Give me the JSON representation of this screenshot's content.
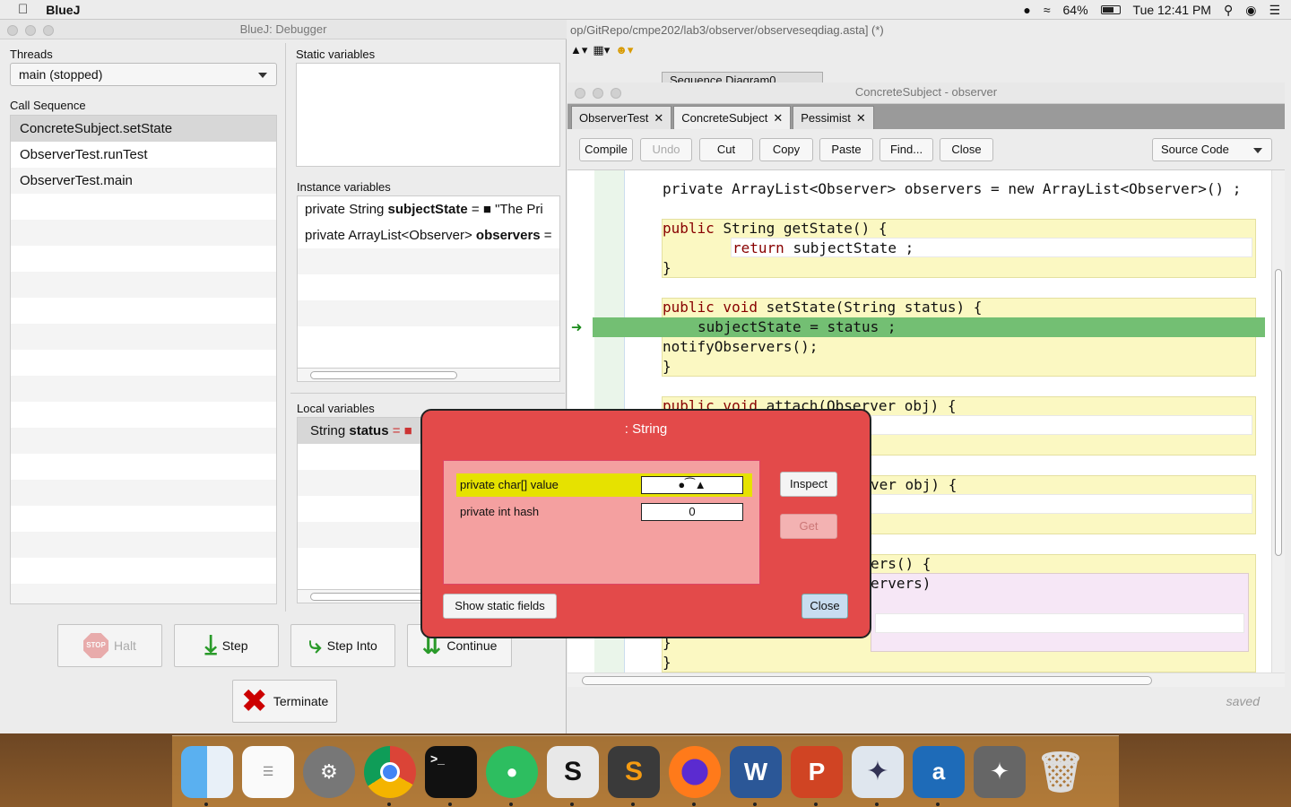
{
  "menubar": {
    "app_name": "BlueJ",
    "battery": "64%",
    "clock": "Tue 12:41 PM"
  },
  "editor_window": {
    "path_title": "op/GitRepo/cmpe202/lab3/observer/observeseqdiag.asta] (*)",
    "diagram_tab": "Sequence Diagram0",
    "class_window_title": "ConcreteSubject - observer",
    "tabs": [
      {
        "label": "ObserverTest"
      },
      {
        "label": "ConcreteSubject"
      },
      {
        "label": "Pessimist"
      }
    ],
    "toolbar": {
      "compile": "Compile",
      "undo": "Undo",
      "cut": "Cut",
      "copy": "Copy",
      "paste": "Paste",
      "find": "Find...",
      "close": "Close",
      "view_mode": "Source Code"
    },
    "code": {
      "l1": "private ArrayList<Observer> observers = new ArrayList<Observer>() ;",
      "l2a": "public ",
      "l2b": "String getState() {",
      "l3a": "return ",
      "l3b": "subjectState ;",
      "l4": "}",
      "l5a": "public void ",
      "l5b": "setState(String status) {",
      "l6": "subjectState = status ;",
      "l7": "notifyObservers();",
      "l8": "}",
      "l9a": "public void ",
      "l9b": "attach(Observer obj) {",
      "l10": "ver obj) {",
      "l11": "ers() {",
      "l12": "ervers)",
      "l13": "}",
      "l14": "}"
    },
    "status": "saved"
  },
  "debugger": {
    "title": "BlueJ:  Debugger",
    "threads_label": "Threads",
    "thread_selected": "main (stopped)",
    "call_sequence_label": "Call Sequence",
    "call_sequence": [
      "ConcreteSubject.setState",
      "ObserverTest.runTest",
      "ObserverTest.main"
    ],
    "static_vars_label": "Static variables",
    "instance_vars_label": "Instance variables",
    "instance_vars": [
      {
        "prefix": "private String ",
        "name": "subjectState",
        "suffix": " = ■ \"The Pri"
      },
      {
        "prefix": "private ArrayList<Observer> ",
        "name": "observers",
        "suffix": " ="
      }
    ],
    "local_vars_label": "Local variables",
    "local_vars": [
      {
        "prefix": "String ",
        "name": "status",
        "suffix": " = ■"
      }
    ],
    "buttons": {
      "halt": "Halt",
      "step": "Step",
      "step_into": "Step Into",
      "continue": "Continue",
      "terminate": "Terminate"
    }
  },
  "inspector": {
    "title": ": String",
    "fields": [
      {
        "label": "private char[] value",
        "value": "●⁀▲"
      },
      {
        "label": "private int hash",
        "value": "0"
      }
    ],
    "inspect": "Inspect",
    "get": "Get",
    "show_static": "Show static fields",
    "close": "Close"
  },
  "dock": {
    "apps": [
      "Finder",
      "Reminders",
      "System Preferences",
      "Chrome",
      "Terminal",
      "Evernote",
      "Slides",
      "Sublime Text",
      "Firefox",
      "Word",
      "PowerPoint",
      "BlueJ",
      "Astah",
      "Greenfoot",
      "Trash"
    ]
  }
}
